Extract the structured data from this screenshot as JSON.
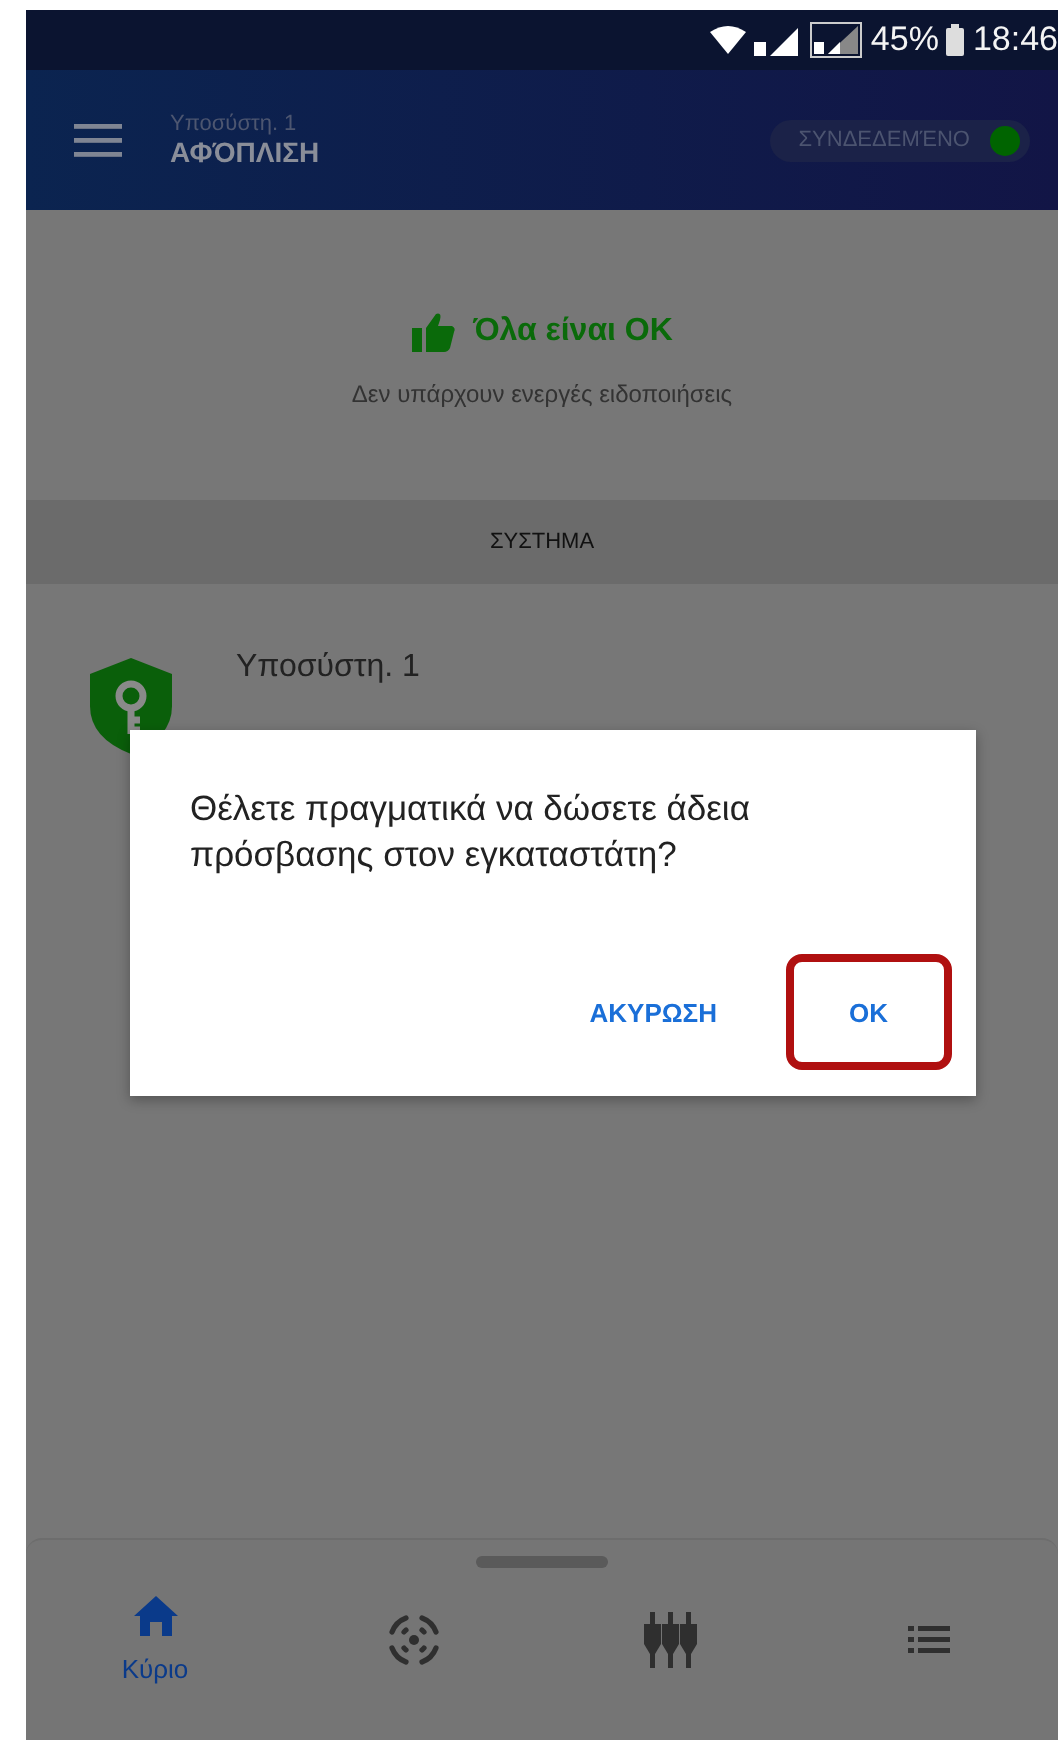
{
  "status_bar": {
    "battery": "45%",
    "time": "18:46"
  },
  "app_bar": {
    "subtitle": "Υποσύστη. 1",
    "title": "ΑΦΌΠΛΙΣΗ",
    "connection": {
      "label": "ΣΥΝΔΕΔΕΜΈΝΟ",
      "color": "#006400"
    }
  },
  "status": {
    "title": "Όλα είναι OK",
    "message": "Δεν υπάρχουν ενεργές ειδοποιήσεις"
  },
  "section_header": "ΣΥΣΤΗΜΑ",
  "subsystems": [
    {
      "name": "Υποσύστη. 1"
    }
  ],
  "dialog": {
    "message": "Θέλετε πραγματικά να δώσετε άδεια πρόσβασης στον εγκαταστάτη?",
    "buttons": [
      {
        "label": "ΑΚΥΡΩΣΗ",
        "highlighted": false
      },
      {
        "label": "OK",
        "highlighted": true
      }
    ]
  },
  "bottom_nav": [
    {
      "kind": "home",
      "label": "Κύριο",
      "selected": true
    },
    {
      "kind": "sensor",
      "selected": false
    },
    {
      "kind": "plugs",
      "selected": false
    },
    {
      "kind": "list",
      "selected": false
    }
  ]
}
